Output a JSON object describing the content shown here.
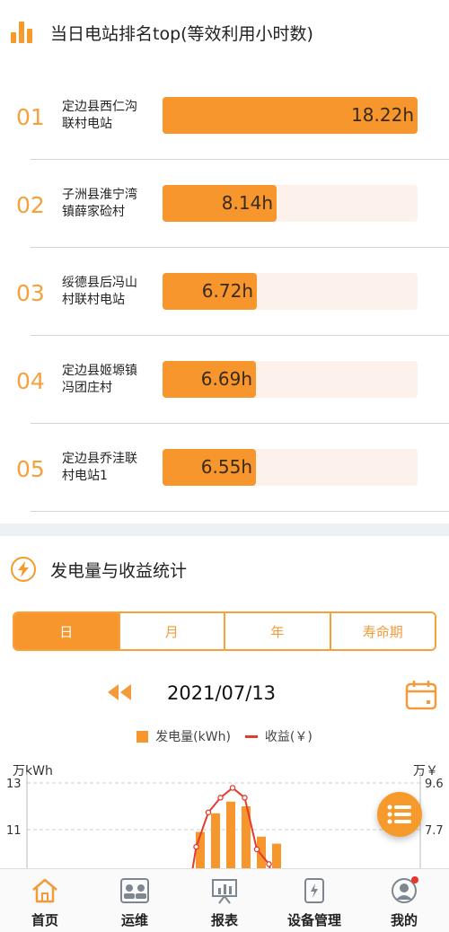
{
  "ranking": {
    "title": "当日电站排名top(等效利用小时数)",
    "max_value": 18.22,
    "items": [
      {
        "rank": "01",
        "name_line1": "定边县西仁沟",
        "name_line2": "联村电站",
        "value": 18.22,
        "value_label": "18.22h"
      },
      {
        "rank": "02",
        "name_line1": "子洲县淮宁湾",
        "name_line2": "镇薛家硷村",
        "value": 8.14,
        "value_label": "8.14h"
      },
      {
        "rank": "03",
        "name_line1": "绥德县后冯山",
        "name_line2": "村联村电站",
        "value": 6.72,
        "value_label": "6.72h"
      },
      {
        "rank": "04",
        "name_line1": "定边县姬塬镇",
        "name_line2": "冯团庄村",
        "value": 6.69,
        "value_label": "6.69h"
      },
      {
        "rank": "05",
        "name_line1": "定边县乔洼联",
        "name_line2": "村电站1",
        "value": 6.55,
        "value_label": "6.55h"
      }
    ]
  },
  "stats": {
    "title": "发电量与收益统计",
    "tabs": [
      {
        "label": "日",
        "active": true
      },
      {
        "label": "月",
        "active": false
      },
      {
        "label": "年",
        "active": false
      },
      {
        "label": "寿命期",
        "active": false
      }
    ],
    "date": "2021/07/13"
  },
  "chart_data": {
    "type": "bar",
    "legend": {
      "bar_label": "发电量(kWh)",
      "line_label": "收益(￥)"
    },
    "left_axis_unit": "万kWh",
    "right_axis_unit": "万￥",
    "left_ticks": [
      "13",
      "11"
    ],
    "right_ticks": [
      "9.6",
      "7.7"
    ],
    "ylim_left": [
      7,
      13
    ],
    "ylim_right": [
      4.0,
      9.6
    ],
    "series": [
      {
        "name": "发电量(kWh)",
        "kind": "bar",
        "values": [
          10.9,
          11.7,
          12.2,
          12.0,
          10.7,
          10.4
        ]
      },
      {
        "name": "收益(￥)",
        "kind": "line",
        "values": [
          4.0,
          7.0,
          8.4,
          9.0,
          9.4,
          9.0,
          6.9,
          6.3,
          4.0
        ]
      }
    ],
    "colors": {
      "bar": "#f6962c",
      "line": "#e43b2e",
      "grid": "#cfcfcf"
    }
  },
  "nav": {
    "items": [
      {
        "label": "首页",
        "icon": "home-icon",
        "active": true
      },
      {
        "label": "运维",
        "icon": "operations-icon",
        "active": false
      },
      {
        "label": "报表",
        "icon": "report-icon",
        "active": false
      },
      {
        "label": "设备管理",
        "icon": "device-icon",
        "active": false
      },
      {
        "label": "我的",
        "icon": "profile-icon",
        "active": false
      }
    ]
  },
  "theme": {
    "accent": "#f6962c",
    "track": "#fdf1ec",
    "divider": "#ced7de"
  }
}
